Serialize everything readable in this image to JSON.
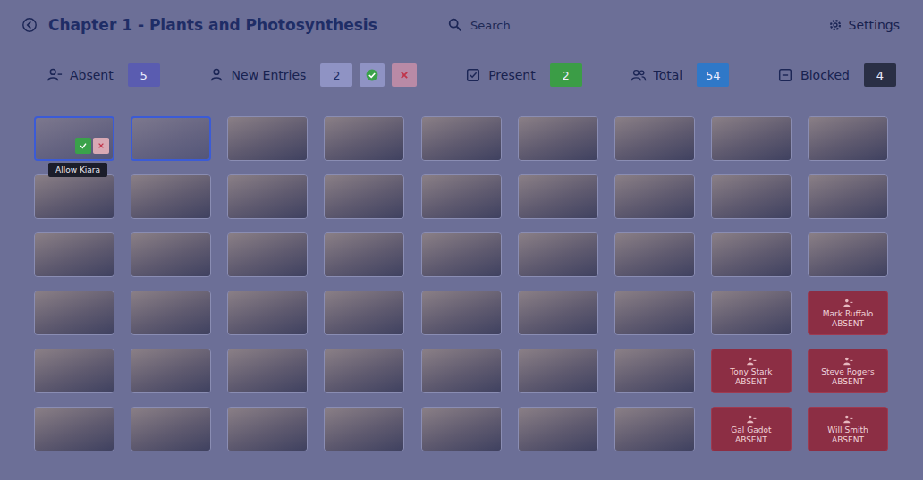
{
  "header": {
    "title": "Chapter 1 - Plants and Photosynthesis",
    "search": {
      "placeholder": "Search"
    },
    "settings": "Settings"
  },
  "stats": [
    {
      "kind": "absent",
      "label": "Absent",
      "count": "5",
      "color": "#5a5cb0"
    },
    {
      "kind": "new",
      "label": "New Entries",
      "count": "2",
      "color": "#8f93c4"
    },
    {
      "kind": "present",
      "label": "Present",
      "count": "2",
      "color": "#3b9d46"
    },
    {
      "kind": "total",
      "label": "Total",
      "count": "54",
      "color": "#2f78c8"
    },
    {
      "kind": "blocked",
      "label": "Blocked",
      "count": "4",
      "color": "#2a2f45"
    }
  ],
  "tiles": [
    {
      "kind": "new",
      "selected": true,
      "tooltip": "Allow Kiara"
    },
    {
      "kind": "new",
      "selected": false
    },
    {
      "kind": "photo",
      "selected": false
    },
    {
      "kind": "photo",
      "selected": false
    },
    {
      "kind": "photo",
      "selected": false
    },
    {
      "kind": "photo",
      "selected": false
    },
    {
      "kind": "photo",
      "selected": false
    },
    {
      "kind": "photo",
      "selected": false
    },
    {
      "kind": "photo",
      "selected": false
    },
    {
      "kind": "photo",
      "selected": false
    },
    {
      "kind": "photo",
      "selected": false
    },
    {
      "kind": "photo",
      "selected": false
    },
    {
      "kind": "photo",
      "selected": false
    },
    {
      "kind": "photo",
      "selected": false
    },
    {
      "kind": "photo",
      "selected": false
    },
    {
      "kind": "photo",
      "selected": false
    },
    {
      "kind": "photo",
      "selected": false
    },
    {
      "kind": "photo",
      "selected": false
    },
    {
      "kind": "photo",
      "selected": false
    },
    {
      "kind": "photo",
      "selected": false
    },
    {
      "kind": "photo",
      "selected": false
    },
    {
      "kind": "photo",
      "selected": false
    },
    {
      "kind": "photo",
      "selected": false
    },
    {
      "kind": "photo",
      "selected": false
    },
    {
      "kind": "photo",
      "selected": false
    },
    {
      "kind": "photo",
      "selected": false
    },
    {
      "kind": "photo",
      "selected": false
    },
    {
      "kind": "photo",
      "selected": false
    },
    {
      "kind": "photo",
      "selected": false
    },
    {
      "kind": "photo",
      "selected": false
    },
    {
      "kind": "photo",
      "selected": false
    },
    {
      "kind": "photo",
      "selected": false
    },
    {
      "kind": "photo",
      "selected": false
    },
    {
      "kind": "photo",
      "selected": false
    },
    {
      "kind": "photo",
      "selected": false
    },
    {
      "kind": "absent",
      "selected": false,
      "name": "Mark Ruffalo",
      "status": "ABSENT"
    },
    {
      "kind": "photo",
      "selected": false
    },
    {
      "kind": "photo",
      "selected": false
    },
    {
      "kind": "photo",
      "selected": false
    },
    {
      "kind": "photo",
      "selected": false
    },
    {
      "kind": "photo",
      "selected": false
    },
    {
      "kind": "photo",
      "selected": false
    },
    {
      "kind": "photo",
      "selected": false
    },
    {
      "kind": "absent",
      "selected": false,
      "name": "Tony Stark",
      "status": "ABSENT"
    },
    {
      "kind": "absent",
      "selected": false,
      "name": "Steve Rogers",
      "status": "ABSENT"
    },
    {
      "kind": "photo",
      "selected": false
    },
    {
      "kind": "photo",
      "selected": false
    },
    {
      "kind": "photo",
      "selected": false
    },
    {
      "kind": "photo",
      "selected": false
    },
    {
      "kind": "photo",
      "selected": false
    },
    {
      "kind": "photo",
      "selected": false
    },
    {
      "kind": "photo",
      "selected": false
    },
    {
      "kind": "absent",
      "selected": false,
      "name": "Gal Gadot",
      "status": "ABSENT"
    },
    {
      "kind": "absent",
      "selected": false,
      "name": "Will Smith",
      "status": "ABSENT"
    }
  ]
}
